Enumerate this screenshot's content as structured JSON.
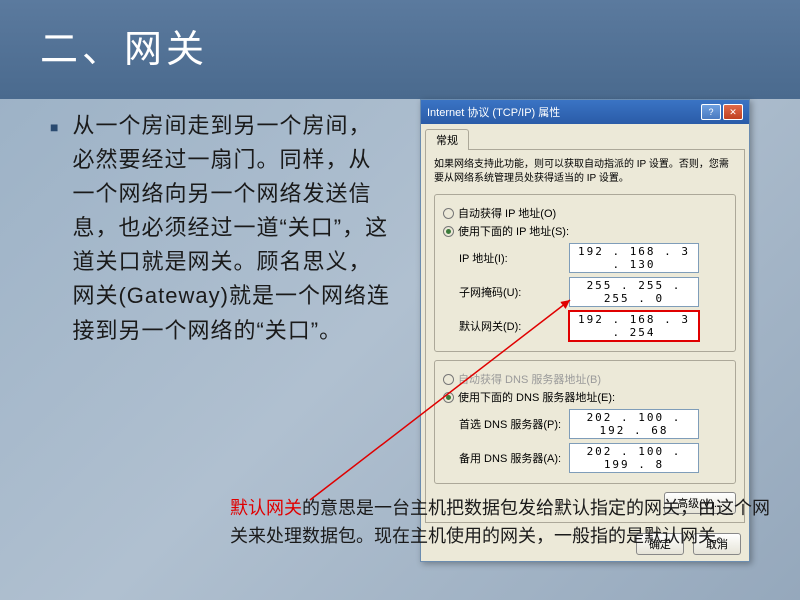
{
  "title": "二、网关",
  "main_paragraph": "从一个房间走到另一个房间，必然要经过一扇门。同样，从一个网络向另一个网络发送信息，也必须经过一道“关口”，这道关口就是网关。顾名思义，网关(Gateway)就是一个网络连接到另一个网络的“关口”。",
  "dialog": {
    "title": "Internet 协议 (TCP/IP) 属性",
    "tab": "常规",
    "description": "如果网络支持此功能，则可以获取自动指派的 IP 设置。否则，您需要从网络系统管理员处获得适当的 IP 设置。",
    "radio_auto_ip": "自动获得 IP 地址(O)",
    "radio_use_ip": "使用下面的 IP 地址(S):",
    "ip_label": "IP 地址(I):",
    "ip_value": "192 . 168 .  3  . 130",
    "mask_label": "子网掩码(U):",
    "mask_value": "255 . 255 . 255 .  0",
    "gw_label": "默认网关(D):",
    "gw_value": "192 . 168 .  3  . 254",
    "radio_auto_dns": "自动获得 DNS 服务器地址(B)",
    "radio_use_dns": "使用下面的 DNS 服务器地址(E):",
    "dns1_label": "首选 DNS 服务器(P):",
    "dns1_value": "202 . 100 . 192 . 68",
    "dns2_label": "备用 DNS 服务器(A):",
    "dns2_value": "202 . 100 . 199 .  8",
    "advanced": "高级(V)...",
    "ok": "确定",
    "cancel": "取消"
  },
  "footer": {
    "red": "默认网关",
    "rest": "的意思是一台主机把数据包发给默认指定的网关，由这个网关来处理数据包。现在主机使用的网关，一般指的是默认网关。"
  }
}
